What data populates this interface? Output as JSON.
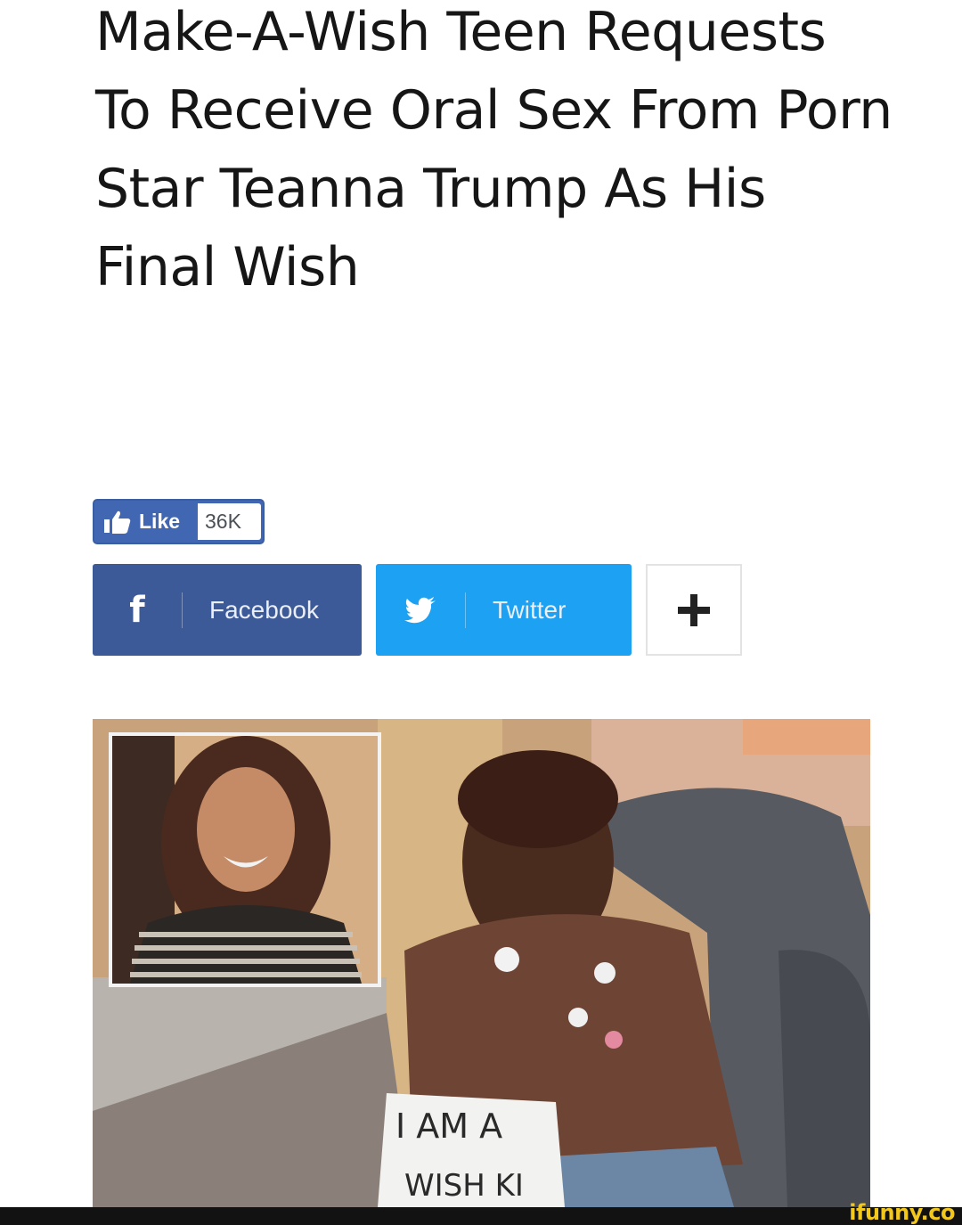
{
  "article": {
    "headline": "Make-A-Wish Teen Requests To Receive Oral Sex From Porn Star Teanna Trump As His Final Wish"
  },
  "like": {
    "label": "Like",
    "count": "36K",
    "icon": "thumbs-up-icon"
  },
  "share": {
    "facebook": {
      "label": "Facebook",
      "icon": "facebook-icon",
      "color": "#3d5a98"
    },
    "twitter": {
      "label": "Twitter",
      "icon": "twitter-bird-icon",
      "color": "#1da1f2"
    },
    "more": {
      "icon": "plus-icon"
    }
  },
  "photo": {
    "sign_text": "I AM A WISH KID"
  },
  "watermark": {
    "text": "ifunny.co",
    "color": "#f2c81d"
  }
}
